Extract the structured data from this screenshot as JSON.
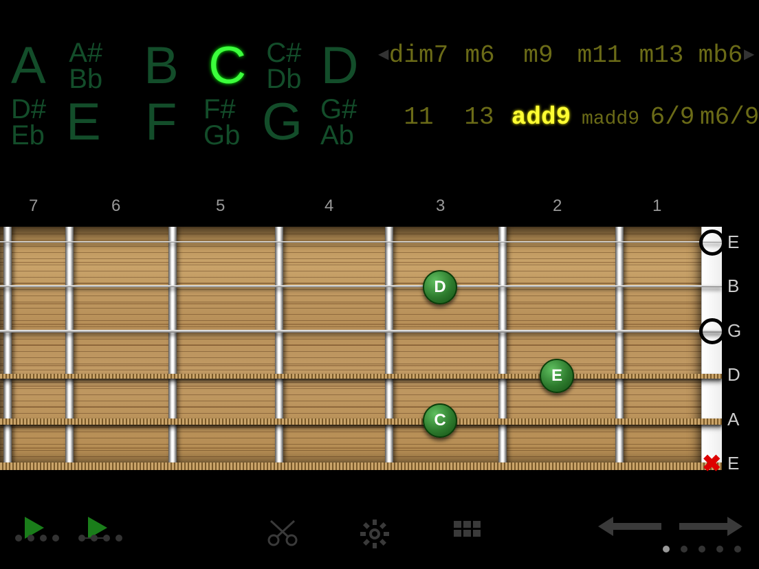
{
  "notes": {
    "row1": [
      {
        "t": "A",
        "kind": "big",
        "w": 85
      },
      {
        "t": "A#\nBb",
        "kind": "pair",
        "w": 110
      },
      {
        "t": "B",
        "kind": "big",
        "w": 95
      },
      {
        "t": "C",
        "kind": "big",
        "w": 85,
        "active": true
      },
      {
        "t": "C#\nDb",
        "kind": "pair",
        "w": 80
      },
      {
        "t": "D",
        "kind": "big",
        "w": 70
      }
    ],
    "row2": [
      {
        "t": "D#\nEb",
        "kind": "pair",
        "w": 80
      },
      {
        "t": "E",
        "kind": "big",
        "w": 115
      },
      {
        "t": "F",
        "kind": "big",
        "w": 85
      },
      {
        "t": "F#\nGb",
        "kind": "pair",
        "w": 85
      },
      {
        "t": "G",
        "kind": "big",
        "w": 85
      },
      {
        "t": "G#\nAb",
        "kind": "pair",
        "w": 70
      }
    ]
  },
  "types": {
    "row1": [
      {
        "t": "dim7",
        "w": 98
      },
      {
        "t": "m6",
        "w": 80
      },
      {
        "t": "m9",
        "w": 90
      },
      {
        "t": "m11",
        "w": 88
      },
      {
        "t": "m13",
        "w": 92
      },
      {
        "t": "mb6",
        "w": 80
      }
    ],
    "row2": [
      {
        "t": "11",
        "w": 98
      },
      {
        "t": "13",
        "w": 78
      },
      {
        "t": "add9",
        "w": 102,
        "active": true
      },
      {
        "t": "madd9",
        "w": 100,
        "small": true
      },
      {
        "t": "6/9",
        "w": 80
      },
      {
        "t": "m6/9",
        "w": 80
      }
    ]
  },
  "fret_numbers": [
    "7",
    "6",
    "5",
    "4",
    "3",
    "2",
    "1"
  ],
  "fret_x": [
    5,
    95,
    245,
    400,
    560,
    725,
    895
  ],
  "string_names": [
    "E",
    "B",
    "G",
    "D",
    "A",
    "E"
  ],
  "string_y": [
    21,
    85,
    150,
    214,
    279,
    343
  ],
  "nut_markers": [
    {
      "s": 0,
      "kind": "open"
    },
    {
      "s": 1,
      "kind": "none"
    },
    {
      "s": 2,
      "kind": "open"
    },
    {
      "s": 3,
      "kind": "none"
    },
    {
      "s": 4,
      "kind": "none"
    },
    {
      "s": 5,
      "kind": "mute"
    }
  ],
  "fingers": [
    {
      "fret": 3,
      "string": 1,
      "label": "D"
    },
    {
      "fret": 2,
      "string": 3,
      "label": "E"
    },
    {
      "fret": 3,
      "string": 4,
      "label": "C"
    }
  ],
  "slot_centers": {
    "1": 955,
    "2": 810,
    "3": 640,
    "4": 478,
    "5": 320,
    "6": 168,
    "7": 48
  },
  "page_dots": {
    "count": 5,
    "active": 0
  }
}
